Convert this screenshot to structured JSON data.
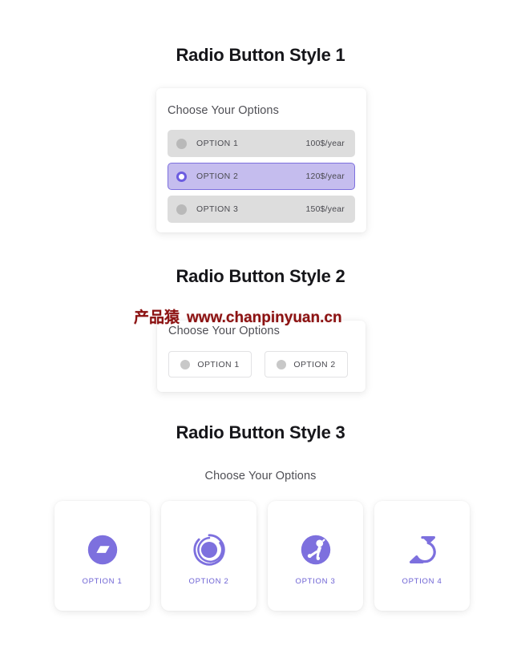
{
  "colors": {
    "accent": "#7d70de",
    "accent_dark": "#6b5ce0",
    "selected_row_bg": "#c5bdee",
    "row_bg": "#dddddd",
    "heading": "#16161a",
    "body_text": "#4a4a50",
    "page_bg": "#ffffff",
    "watermark": "#8c1212"
  },
  "sections": [
    {
      "title": "Radio Button Style 1",
      "card_label": "Choose Your Options",
      "options": [
        {
          "name": "OPTION 1",
          "price": "100$/year",
          "selected": false
        },
        {
          "name": "OPTION 2",
          "price": "120$/year",
          "selected": true
        },
        {
          "name": "OPTION 3",
          "price": "150$/year",
          "selected": false
        }
      ]
    },
    {
      "title": "Radio Button Style 2",
      "card_label": "Choose Your Options",
      "options": [
        {
          "name": "OPTION 1",
          "selected": false
        },
        {
          "name": "OPTION 2",
          "selected": false
        }
      ]
    },
    {
      "title": "Radio Button Style 3",
      "card_label": "Choose Your Options",
      "options": [
        {
          "name": "OPTION 1",
          "icon": "parallelogram-circle-icon",
          "selected": false
        },
        {
          "name": "OPTION 2",
          "icon": "swirl-ring-circle-icon",
          "selected": false
        },
        {
          "name": "OPTION 3",
          "icon": "astronaut-circle-icon",
          "selected": false
        },
        {
          "name": "OPTION 4",
          "icon": "pointed-ring-icon",
          "selected": false
        }
      ]
    }
  ],
  "watermark": {
    "brand_cn": "产品猿",
    "url": "www.chanpinyuan.cn"
  }
}
